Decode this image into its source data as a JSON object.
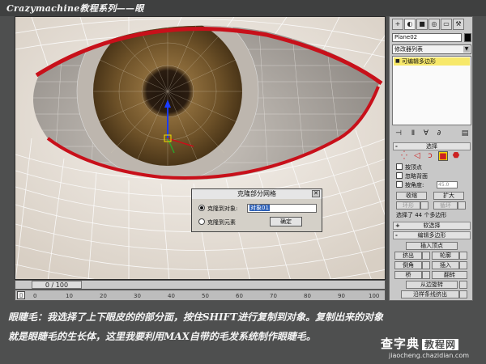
{
  "header": {
    "title": "Crazymachine教程系列——眼"
  },
  "timeline": {
    "slider_label": "0 / 100",
    "ticks": [
      "0",
      "10",
      "20",
      "30",
      "40",
      "50",
      "60",
      "70",
      "80",
      "90",
      "100"
    ]
  },
  "panel": {
    "tabs": [
      "+",
      "◐",
      "■",
      "◎",
      "▭",
      "⚒"
    ],
    "object_name": "Plane02",
    "object_color": "#050505",
    "modifier_list_label": "修改器列表",
    "stack_item": "可编辑多边形",
    "rollout_selection": "选择",
    "by_vertex": "按顶点",
    "ignore_backfacing": "忽略背面",
    "by_angle": "按角度:",
    "angle_value": "45.0",
    "shrink": "收缩",
    "grow": "扩大",
    "ring": "环形",
    "loop": "循环",
    "selection_status": "选择了 44 个多边形",
    "rollout_soft": "软选择",
    "rollout_edit_poly": "编辑多边形",
    "insert_vertex": "插入顶点",
    "extrude": "挤出",
    "outline": "轮廓",
    "bevel": "倒角",
    "inset": "插入",
    "bridge": "桥",
    "flip": "翻转",
    "hinge": "从边旋转",
    "extrude_along_spline": "沿样条线挤出"
  },
  "dialog": {
    "title": "克隆部分网格",
    "clone_to_object": "克隆到对象:",
    "object_value": "对象01",
    "clone_to_element": "克隆到元素",
    "ok": "确定"
  },
  "caption": {
    "line1": "眼睫毛：我选择了上下眼皮的的部分面，按住SHIFT进行复制到对象。复制出来的对象",
    "line2": "就是眼睫毛的生长体，这里我要利用MAX自带的毛发系统制作眼睫毛。"
  },
  "watermark": {
    "brand": "查字典",
    "tag": "教程网",
    "url": "jiaocheng.chazidian.com"
  },
  "colors": {
    "selection_red": "#c8101a",
    "iris": "#7a5a2a",
    "stack_highlight": "#f7e86a",
    "gizmo_blue": "#1a3cff"
  }
}
